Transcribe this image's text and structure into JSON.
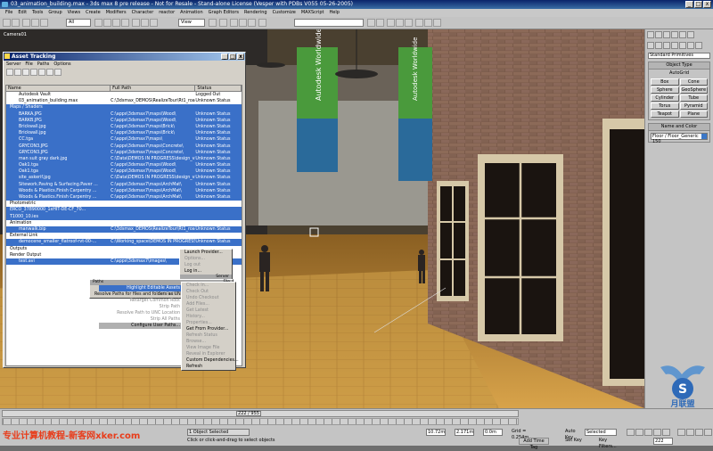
{
  "app": {
    "title": "03_animation_building.max - 3ds max 8 pre release - Not for Resale - Stand-alone License (Vesper with PDBs V055 05-26-2005)",
    "win_min": "_",
    "win_max": "□",
    "win_close": "x"
  },
  "menubar": [
    "File",
    "Edit",
    "Tools",
    "Group",
    "Views",
    "Create",
    "Modifiers",
    "Character",
    "reactor",
    "Animation",
    "Graph Editors",
    "Rendering",
    "Customize",
    "MAXScript",
    "Help"
  ],
  "toolbar": {
    "selection_filter": "All",
    "ref_coord": "View"
  },
  "viewport": {
    "label": "Camera01",
    "banner_text": "Autodesk Worldwide"
  },
  "command_panel": {
    "dropdown": "Standard Primitives",
    "object_type_title": "Object Type",
    "autogrid": "AutoGrid",
    "primitives": [
      "Box",
      "Cone",
      "Sphere",
      "GeoSphere",
      "Cylinder",
      "Tube",
      "Torus",
      "Pyramid",
      "Teapot",
      "Plane"
    ],
    "name_color_title": "Name and Color",
    "name_value": "Floor / Floor_Generic 150"
  },
  "asset_tracking": {
    "title": "Asset Tracking",
    "close": "x",
    "min": "_",
    "max": "□",
    "menu": [
      "Server",
      "File",
      "Paths",
      "Options"
    ],
    "columns": [
      "Name",
      "Full Path",
      "Status"
    ],
    "rows": [
      {
        "name": "Autodesk Vault",
        "path": "",
        "status": "Logged Out",
        "sel": false
      },
      {
        "name": "03_animation_building.max",
        "path": "C:\\3dsmax_DEMOS\\RealizeTour\\Rt1_roadb...",
        "status": "Unknown Status",
        "sel": false
      },
      {
        "name": "Maps / Shaders",
        "path": "",
        "status": "",
        "sel": true
      },
      {
        "name": "BARKA.JPG",
        "path": "C:\\apps\\3dsmax7\\maps\\Wood\\",
        "status": "Unknown Status",
        "sel": true
      },
      {
        "name": "BARKB.JPG",
        "path": "C:\\apps\\3dsmax7\\maps\\Wood\\",
        "status": "Unknown Status",
        "sel": true
      },
      {
        "name": "Brickwall.jpg",
        "path": "C:\\apps\\3dsmax7\\maps\\Brick\\",
        "status": "Unknown Status",
        "sel": true
      },
      {
        "name": "Brickwall.jpg",
        "path": "C:\\apps\\3dsmax7\\maps\\Brick\\",
        "status": "Unknown Status",
        "sel": true
      },
      {
        "name": "CC.tga",
        "path": "C:\\apps\\3dsmax7\\maps\\",
        "status": "Unknown Status",
        "sel": true
      },
      {
        "name": "GRYCON3.JPG",
        "path": "C:\\apps\\3dsmax7\\maps\\Concrete\\",
        "status": "Unknown Status",
        "sel": true
      },
      {
        "name": "GRYCON3.JPG",
        "path": "C:\\apps\\3dsmax7\\maps\\Concrete\\",
        "status": "Unknown Status",
        "sel": true
      },
      {
        "name": "man suit gray dark.jpg",
        "path": "C:\\Data\\DEMOS IN PROGRESS\\design_viz\\...",
        "status": "Unknown Status",
        "sel": true
      },
      {
        "name": "Oak1.tga",
        "path": "C:\\apps\\3dsmax7\\maps\\Wood\\",
        "status": "Unknown Status",
        "sel": true
      },
      {
        "name": "Oak1.tga",
        "path": "C:\\apps\\3dsmax7\\maps\\Wood\\",
        "status": "Unknown Status",
        "sel": true
      },
      {
        "name": "site_askerif.jpg",
        "path": "C:\\Data\\DEMOS IN PROGRESS\\design_viz\\...",
        "status": "Unknown Status",
        "sel": true
      },
      {
        "name": "Sitework.Paving & Surfacing.Paver ...",
        "path": "C:\\apps\\3dsmax7\\maps\\ArchMat\\",
        "status": "Unknown Status",
        "sel": true
      },
      {
        "name": "Woods & Plastics.Finish Carpentry ...",
        "path": "C:\\apps\\3dsmax7\\maps\\ArchMat\\",
        "status": "Unknown Status",
        "sel": true
      },
      {
        "name": "Woods & Plastics.Finish Carpentry ...",
        "path": "C:\\apps\\3dsmax7\\maps\\ArchMat\\",
        "status": "Unknown Status",
        "sel": true
      },
      {
        "name": "Photometric",
        "path": "",
        "status": "",
        "sel": false
      },
      {
        "name": "ERCO_37890000_1xHIT-DE-CF_70...",
        "path": "",
        "status": "",
        "sel": true
      },
      {
        "name": "T1000_10.ies",
        "path": "",
        "status": "",
        "sel": true
      },
      {
        "name": "Animation",
        "path": "",
        "status": "",
        "sel": false
      },
      {
        "name": "manwalk.bip",
        "path": "C:\\3dsmax_DEMOS\\RealizeTour\\Rt1_roadb...",
        "status": "Unknown Status",
        "sel": true
      },
      {
        "name": "External Link",
        "path": "",
        "status": "",
        "sel": false
      },
      {
        "name": "democene_smaller_flatroof-rvt-00-...",
        "path": "C:\\Working_space\\DEMOS IN PROGRESS\\...",
        "status": "Unknown Status",
        "sel": true
      },
      {
        "name": "Outputs",
        "path": "",
        "status": "",
        "sel": false
      },
      {
        "name": "Render Output",
        "path": "",
        "status": "",
        "sel": false
      },
      {
        "name": "test.avi",
        "path": "C:\\apps\\3dsmax7\\images\\",
        "status": "Unknown Status",
        "sel": true
      }
    ]
  },
  "server_menu": {
    "items": [
      "Launch Provider...",
      "Options...",
      "Log out",
      "Log in...",
      "Server"
    ]
  },
  "paths_menu": {
    "header_left": "Paths",
    "header_right": "File",
    "items": [
      "Highlight Editable Assets",
      "Set Path...",
      "Retarget Common Root",
      "Strip Path",
      "Resolve Path to UNC Location",
      "Strip All Paths",
      "Configure User Paths...",
      "Resolve Paths for files and folders as UNC"
    ]
  },
  "file_menu": {
    "items": [
      "Check In...",
      "Check Out",
      "Undo Checkout",
      "Add Files...",
      "Get Latest",
      "History...",
      "Properties...",
      "Get From Provider...",
      "Refresh Status",
      "Browse...",
      "View Image File",
      "Reveal in Explorer",
      "Custom Dependencies...",
      "Refresh"
    ]
  },
  "status": {
    "timeline_frame": "222 / 955",
    "selected": "1 Object Selected",
    "prompt": "Click or click-and-drag to select objects",
    "x_val": "10.72m",
    "y_val": "2.171m",
    "z_val": "0.0m",
    "grid": "Grid = 0.254m",
    "auto_key": "Auto Key",
    "set_key": "Set Key",
    "key_filters": "Key Filters...",
    "selected_dd": "Selected",
    "add_time_tag": "Add Time Tag",
    "frame_field": "222"
  },
  "watermark": {
    "text": "专业计算机教程-新客网xker.com",
    "logo_text": "月联盟"
  }
}
